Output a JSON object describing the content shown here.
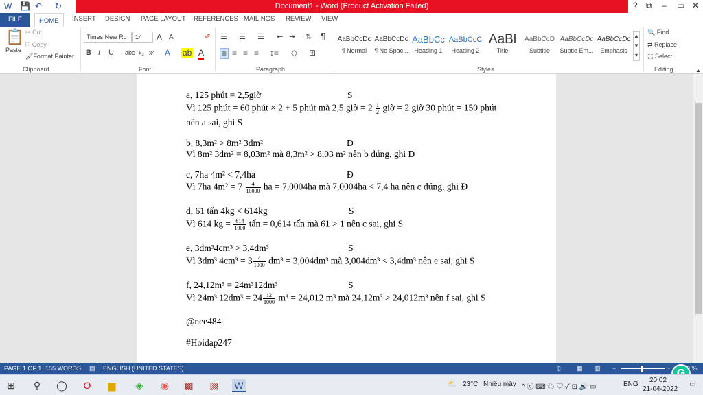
{
  "window": {
    "title": "Document1 - Word (Product Activation Failed)",
    "help": "?",
    "min": "–",
    "max": "▭",
    "close": "✕",
    "ribbon_display": "⧉"
  },
  "quick_access": {
    "save_icon": "save-icon",
    "undo_icon": "undo-icon",
    "redo_icon": "redo-icon"
  },
  "tabs": [
    "FILE",
    "HOME",
    "INSERT",
    "DESIGN",
    "PAGE LAYOUT",
    "REFERENCES",
    "MAILINGS",
    "REVIEW",
    "VIEW"
  ],
  "clipboard": {
    "paste": "Paste",
    "cut": "Cut",
    "copy": "Copy",
    "format_painter": "Format Painter",
    "label": "Clipboard"
  },
  "font": {
    "name": "Times New Ro",
    "size": "14",
    "label": "Font",
    "bold": "B",
    "italic": "I",
    "underline": "U",
    "strike": "abc",
    "sub": "x₂",
    "sup": "x²",
    "grow": "A",
    "shrink": "A",
    "clear": "✐"
  },
  "paragraph": {
    "label": "Paragraph",
    "pilcrow": "¶"
  },
  "styles": {
    "label": "Styles",
    "items": [
      {
        "sample": "AaBbCcDc",
        "name": "¶ Normal"
      },
      {
        "sample": "AaBbCcDc",
        "name": "¶ No Spac..."
      },
      {
        "sample": "AaBbCc",
        "name": "Heading 1"
      },
      {
        "sample": "AaBbCcC",
        "name": "Heading 2"
      },
      {
        "sample": "AaBl",
        "name": "Title"
      },
      {
        "sample": "AaBbCcD",
        "name": "Subtitle"
      },
      {
        "sample": "AaBbCcDc",
        "name": "Subtle Em..."
      },
      {
        "sample": "AaBbCcDc",
        "name": "Emphasis"
      }
    ]
  },
  "editing": {
    "label": "Editing",
    "find": "Find",
    "replace": "Replace",
    "select": "Select"
  },
  "doc": {
    "l1": "a, 125 phút = 2,5giờ",
    "m1": "S",
    "l2a": "Vì 125 phút = 60 phút × 2 + 5 phút mà 2,5 giờ = 2 ",
    "l2n": "1",
    "l2d": "2",
    "l2b": " giờ = 2 giờ 30 phút = 150 phút",
    "l3": "nên a sai, ghi S",
    "l4": "b, 8,3m² > 8m² 3dm²",
    "m4": "Đ",
    "l5": "Vì  8m² 3dm² = 8,03m² mà 8,3m² > 8,03 m² nên b đúng, ghi Đ",
    "l6": "c, 7ha 4m² < 7,4ha",
    "m6": "Đ",
    "l7a": "Vì 7ha 4m² = 7 ",
    "l7n": "4",
    "l7d": "10000",
    "l7b": " ha = 7,0004ha mà 7,0004ha < 7,4 ha nên c đúng, ghi Đ",
    "l8": "d, 61 tấn 4kg < 614kg",
    "m8": "S",
    "l9a": "Vì 614 kg = ",
    "l9n": "614",
    "l9d": "1000",
    "l9b": " tấn = 0,614 tấn mà 61 > 1 nên c sai, ghi S",
    "l10": "e, 3dm³4cm³ > 3,4dm³",
    "m10": "S",
    "l11a": "Vì 3dm³ 4cm³ = 3",
    "l11n": "4",
    "l11d": "1000",
    "l11b": " dm³ = 3,004dm³ mà 3,004dm³ < 3,4dm³ nên e sai, ghi S",
    "l12": "f, 24,12m³ = 24m³12dm³",
    "m12": "S",
    "l13a": "Vì 24m³ 12dm³ = 24",
    "l13n": "12",
    "l13d": "1000",
    "l13b": " m³ = 24,012 m³ mà 24,12m³ > 24,012m³ nên f sai, ghi S",
    "l14": "@nee484",
    "l15": "#Hoidap247"
  },
  "status": {
    "page": "PAGE 1 OF 1",
    "words": "155 WORDS",
    "lang": "ENGLISH (UNITED STATES)",
    "zoom": "9 %"
  },
  "taskbar": {
    "weather_temp": "23°C",
    "weather_text": "Nhiều mây",
    "lang": "ENG",
    "time": "20:02",
    "date": "21-04-2022"
  }
}
